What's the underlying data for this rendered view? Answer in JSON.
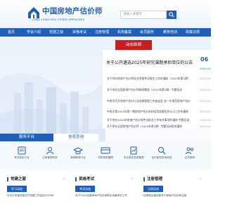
{
  "header": {
    "logo_cn": "中国房地产估价师",
    "logo_en": "CMBA   CHINA REAL ESTATE APPRAISERS",
    "search_placeholder": "请输入关键字",
    "brand_color": "#1f5fb8"
  },
  "nav": {
    "items": [
      {
        "label": "首页"
      },
      {
        "label": "学会介绍"
      },
      {
        "label": "党建之窗"
      },
      {
        "label": "资格考试"
      },
      {
        "label": "注册管理"
      },
      {
        "label": "机构备案"
      },
      {
        "label": "会员服务"
      },
      {
        "label": "教育培训"
      },
      {
        "label": "政策法规"
      }
    ]
  },
  "news": {
    "tab_label": "动态新闻",
    "tab_color": "#c81e1e",
    "headline": "关于公开遴选2025年研究课题承担单位的公告",
    "headline_day": "06",
    "headline_date": "2025-05",
    "rows": [
      {
        "title": "关于举办房地产估价师执业资格考试报名工作的通知（2025年第1期）",
        "date": "2025-05-06"
      },
      {
        "title": "关于举办全国房地产估价师继续教育（2025年第1期）专题培训",
        "date": "2025-04-28"
      },
      {
        "title": "中房学召开房地产估价行业自律管理工作座谈会 进一步规范房地产估价",
        "date": "2025-04-25"
      },
      {
        "title": "中房学第2024年第一期房地产估价机构信用档案信息公示工作的通知",
        "date": "2025-04-22"
      },
      {
        "title": "关于举办2025年房地产估价师考试报名工作有关事项的通知 专题培训",
        "date": "2025-04-18"
      },
      {
        "title": "关于举办全国房地产估价师（2025年第1期）专题培训班的通知",
        "date": "2025-04-15"
      }
    ]
  },
  "tabs": {
    "active": "服务平台",
    "other": "信息查询"
  },
  "services": [
    {
      "label": "考试报名平台",
      "icon": "exam-icon"
    },
    {
      "label": "注册管理系统",
      "icon": "registration-icon"
    },
    {
      "label": "继续教育平台",
      "icon": "education-icon"
    },
    {
      "label": "机构信用管理",
      "icon": "credit-icon"
    },
    {
      "label": "专业报告信息管理",
      "icon": "report-icon"
    },
    {
      "label": "估价报告查询系统",
      "icon": "query-icon"
    },
    {
      "label": "会员服务",
      "icon": "member-icon"
    }
  ],
  "sections": [
    {
      "title": "党建之窗",
      "pill": "学习动态",
      "line": "中共中央宣传部召开党建工作会议2025年"
    },
    {
      "title": "资格考试",
      "pill": "考试动态",
      "line": "关于2025年度房地产估价师职业资格考试工作"
    },
    {
      "title": "注册管理",
      "pill": "注册动态",
      "line": "住房城乡建设部关于房地产估价师注册"
    }
  ]
}
